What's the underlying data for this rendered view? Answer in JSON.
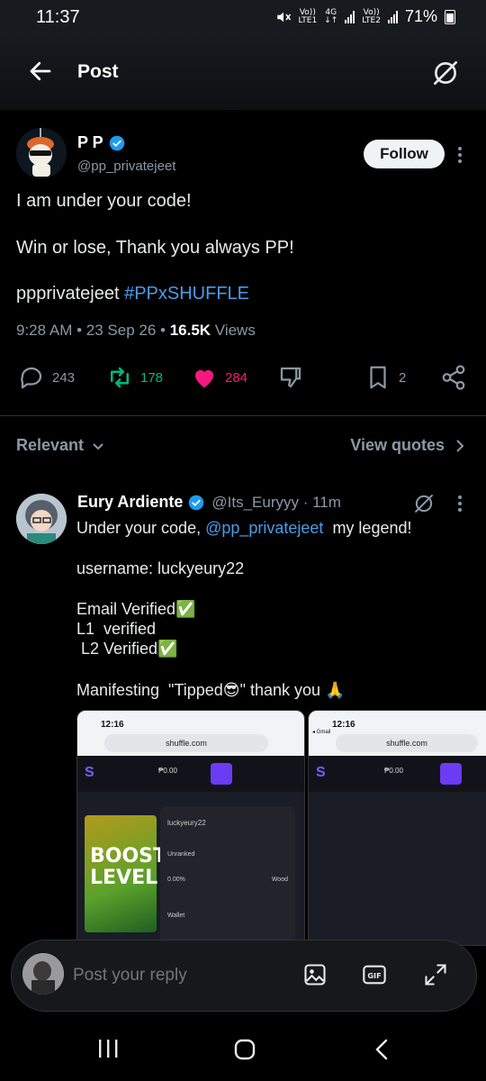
{
  "status_bar": {
    "time": "11:37",
    "lte1_top": "Vo))",
    "lte1_bottom": "LTE1",
    "net_top": "4G",
    "net_bottom": "↓↑",
    "lte2_top": "Vo))",
    "lte2_bottom": "LTE2",
    "battery_percent": "71%"
  },
  "header": {
    "title": "Post"
  },
  "post": {
    "name": "P P",
    "handle": "@pp_privatejeet",
    "follow_label": "Follow",
    "line1": "I am under your code!",
    "line2": "Win or lose, Thank you always PP!",
    "line3_text": "ppprivatejeet ",
    "line3_hashtag": "#PPxSHUFFLE",
    "meta_time": "9:28 AM • 23 Sep 26 • ",
    "meta_views_count": "16.5K",
    "meta_views_label": " Views",
    "replies": "243",
    "reposts": "178",
    "likes": "284",
    "bookmarks": "2"
  },
  "colors": {
    "accent": "#4a9ce8",
    "repost": "#00ba7c",
    "like": "#f91880"
  },
  "sort": {
    "left_label": "Relevant",
    "right_label": "View quotes"
  },
  "reply": {
    "name": "Eury Ardiente",
    "handle_time": "@Its_Euryyy · 11m",
    "line1_pre": "Under your code, ",
    "line1_mention": "@pp_privatejeet",
    "line1_post": "  my legend!",
    "line2": "username: luckyeury22",
    "line3": "Email Verified✅",
    "line4": "L1  verified",
    "line5": " L2 Verified✅",
    "line6": "Manifesting  \"Tipped😎\" thank you 🙏",
    "shot1": {
      "time": "12:16",
      "url": "shuffle.com",
      "balance": "₱0.00",
      "promo_line1": "BOOST",
      "promo_line2": "LEVEL",
      "username": "luckyeury22",
      "rank": "Unranked",
      "progress": "0.00%",
      "tier": "Wood",
      "wallet": "Wallet"
    },
    "shot2": {
      "time": "12:16",
      "app_back": "◂ Gmail",
      "url": "shuffle.com",
      "balance": "₱0.00"
    }
  },
  "reply_bar": {
    "placeholder": "Post your reply"
  }
}
